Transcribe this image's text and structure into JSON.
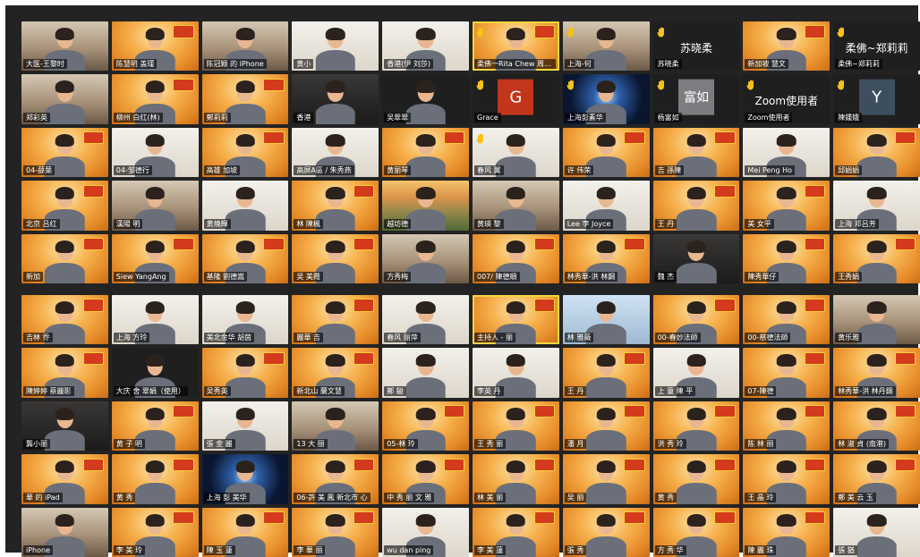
{
  "colors": {
    "screen_bg": "#232323",
    "active_border": "#f2d640",
    "hand": "#f5c21b"
  },
  "panels": [
    {
      "name": "top-panel",
      "tiles": [
        {
          "label": "大医-王黎时",
          "bg": "room"
        },
        {
          "label": "陈慧明 盖瑾",
          "bg": "orange"
        },
        {
          "label": "陈冠颖 的 iPhone",
          "bg": "room"
        },
        {
          "label": "黄小",
          "bg": "white"
        },
        {
          "label": "香港(伊 刘莎)",
          "bg": "white"
        },
        {
          "label": "柔佛一Rita Chew 周燕珠",
          "bg": "orange",
          "active": true,
          "hand": true
        },
        {
          "label": "上海-何",
          "bg": "room",
          "hand": true
        },
        {
          "label": "苏晓柔",
          "bg": "black",
          "center_name": "苏晓柔",
          "hand": true
        },
        {
          "label": "新加坡 慧文",
          "bg": "orange"
        },
        {
          "label": "柔佛~郑莉莉",
          "bg": "black",
          "center_name": "柔佛~郑莉莉",
          "hand": true
        },
        {
          "label": "郑彩英",
          "bg": "room"
        },
        {
          "label": "柳州 白红(林)",
          "bg": "orange"
        },
        {
          "label": "鄭莉莉",
          "bg": "orange"
        },
        {
          "label": "香港",
          "bg": "dark"
        },
        {
          "label": "吴翠翠",
          "bg": "black"
        },
        {
          "label": "Grace",
          "bg": "black",
          "avatar": "G",
          "avatar_color": "red",
          "hand": true
        },
        {
          "label": "上海彭素华",
          "bg": "space",
          "hand": true
        },
        {
          "label": "杨富如",
          "bg": "black",
          "avatar": "富如",
          "avatar_color": "gray",
          "hand": true
        },
        {
          "label": "Zoom使用者",
          "bg": "black",
          "center_name": "Zoom使用者",
          "hand": true
        },
        {
          "label": "陳鍾娥",
          "bg": "black",
          "avatar": "Y",
          "avatar_color": "slate",
          "hand": true
        },
        {
          "label": "04-薛葉",
          "bg": "orange"
        },
        {
          "label": "04-邹德行",
          "bg": "white"
        },
        {
          "label": "高雄 加坡",
          "bg": "orange"
        },
        {
          "label": "高屏A區 / 朱秀燕",
          "bg": "white"
        },
        {
          "label": "黄丽琴",
          "bg": "orange"
        },
        {
          "label": "春风 翼",
          "bg": "white",
          "hand": true
        },
        {
          "label": "许 伟荣",
          "bg": "orange"
        },
        {
          "label": "吉 孫陳",
          "bg": "orange"
        },
        {
          "label": "Mei Peng Ho",
          "bg": "white"
        },
        {
          "label": "邱娟娟",
          "bg": "orange"
        },
        {
          "label": "北京 吕红",
          "bg": "orange"
        },
        {
          "label": "漢陽 明",
          "bg": "room"
        },
        {
          "label": "黄燒輝",
          "bg": "white"
        },
        {
          "label": "林 陳楓",
          "bg": "orange"
        },
        {
          "label": "越坊德",
          "bg": "landscape"
        },
        {
          "label": "黄瑛 黎",
          "bg": "room"
        },
        {
          "label": "Lee 李 Joyce",
          "bg": "white"
        },
        {
          "label": "王 丹",
          "bg": "orange"
        },
        {
          "label": "美 女平",
          "bg": "orange"
        },
        {
          "label": "上海 邓吕芳",
          "bg": "white"
        },
        {
          "label": "新加",
          "bg": "orange"
        },
        {
          "label": "Siew YangAng",
          "bg": "orange"
        },
        {
          "label": "基隆 劉德嵩",
          "bg": "orange"
        },
        {
          "label": "吴 美霞",
          "bg": "orange"
        },
        {
          "label": "方秀梅",
          "bg": "room"
        },
        {
          "label": "007/ 陳德順",
          "bg": "orange"
        },
        {
          "label": "林秀華-洪 林鋼",
          "bg": "orange"
        },
        {
          "label": "魏 杰",
          "bg": "dark"
        },
        {
          "label": "陳秀華仔",
          "bg": "orange"
        },
        {
          "label": "王秀娟",
          "bg": "orange"
        }
      ]
    },
    {
      "name": "bottom-panel",
      "tiles": [
        {
          "label": "吉林 乔",
          "bg": "orange"
        },
        {
          "label": "上海 方玲",
          "bg": "white"
        },
        {
          "label": "美北金华 胡茵",
          "bg": "white"
        },
        {
          "label": "麗華 吉",
          "bg": "orange"
        },
        {
          "label": "春风 丽萍",
          "bg": "white"
        },
        {
          "label": "主持人 - 丽",
          "bg": "orange",
          "active": true
        },
        {
          "label": "林 雅薇",
          "bg": "blue"
        },
        {
          "label": "00-春妙法師",
          "bg": "orange"
        },
        {
          "label": "00-慈德法師",
          "bg": "orange"
        },
        {
          "label": "黄乐雅",
          "bg": "room"
        },
        {
          "label": "陳婷婷 蔡麗影",
          "bg": "orange"
        },
        {
          "label": "大庆 舍 翠娟（使用）",
          "bg": "black"
        },
        {
          "label": "吴秀英",
          "bg": "orange"
        },
        {
          "label": "新北山 蘭文慧",
          "bg": "orange"
        },
        {
          "label": "鄭 鎰",
          "bg": "white"
        },
        {
          "label": "李英 丹",
          "bg": "white"
        },
        {
          "label": "王 丹",
          "bg": "orange"
        },
        {
          "label": "上 童 陳 平",
          "bg": "white"
        },
        {
          "label": "07-陳德",
          "bg": "orange"
        },
        {
          "label": "林秀華-洪 林丹鋼",
          "bg": "orange"
        },
        {
          "label": "龔小丽",
          "bg": "dark"
        },
        {
          "label": "黄 子 明",
          "bg": "orange"
        },
        {
          "label": "張 金 麗",
          "bg": "white"
        },
        {
          "label": "13 大 丽",
          "bg": "room"
        },
        {
          "label": "05-林 玲",
          "bg": "orange"
        },
        {
          "label": "王 秀 丽",
          "bg": "orange"
        },
        {
          "label": "潘 月",
          "bg": "orange"
        },
        {
          "label": "洪 秀 玲",
          "bg": "orange"
        },
        {
          "label": "陈 林 丽",
          "bg": "orange"
        },
        {
          "label": "林 淑 貞 (南港)",
          "bg": "orange"
        },
        {
          "label": "華 的 iPad",
          "bg": "orange"
        },
        {
          "label": "黄 秀",
          "bg": "orange"
        },
        {
          "label": "上海 彭 美华",
          "bg": "space"
        },
        {
          "label": "06-許 美 鳳 新北市 心",
          "bg": "orange"
        },
        {
          "label": "中 秀 丽 文 雅",
          "bg": "orange"
        },
        {
          "label": "林 美 丽",
          "bg": "orange"
        },
        {
          "label": "吴 丽",
          "bg": "orange"
        },
        {
          "label": "黄 秀",
          "bg": "orange"
        },
        {
          "label": "王 晶 玲",
          "bg": "orange"
        },
        {
          "label": "鄭 美 云 玉",
          "bg": "orange"
        },
        {
          "label": "iPhone",
          "bg": "room"
        },
        {
          "label": "李 美 玲",
          "bg": "orange"
        },
        {
          "label": "陳 玉 蓮",
          "bg": "orange"
        },
        {
          "label": "李 華 丽",
          "bg": "orange"
        },
        {
          "label": "wu dan ping",
          "bg": "white"
        },
        {
          "label": "李 美 蓮",
          "bg": "orange"
        },
        {
          "label": "張 秀",
          "bg": "orange"
        },
        {
          "label": "方 秀 华",
          "bg": "orange"
        },
        {
          "label": "陳 麗 珠",
          "bg": "orange"
        },
        {
          "label": "張 猶",
          "bg": "white"
        }
      ]
    }
  ]
}
